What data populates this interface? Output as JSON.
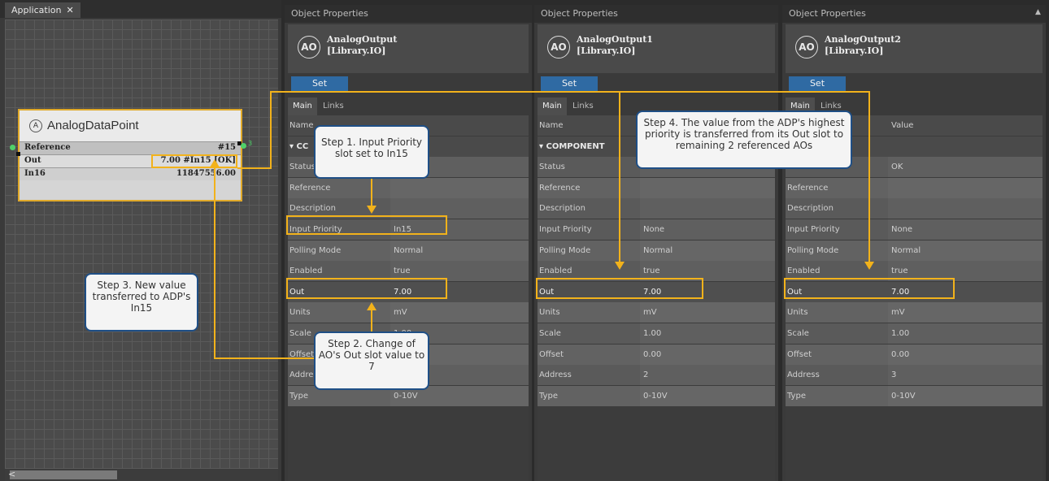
{
  "application": {
    "tab_label": "Application",
    "close_glyph": "✕",
    "scroll_left_glyph": "<"
  },
  "adp": {
    "icon_glyph": "A",
    "title": "AnalogDataPoint",
    "rows": [
      {
        "label": "Reference",
        "value": "#15"
      },
      {
        "label": "Out",
        "value": "7.00 #In15 [OK]"
      },
      {
        "label": "In16",
        "value": "11847556.00"
      }
    ],
    "out_pin_label": "3"
  },
  "panels": [
    {
      "title": "Object Properties",
      "object_name": "AnalogOutput",
      "object_lib": "[Library.IO]",
      "icon": "AO",
      "set_label": "Set",
      "tabs": {
        "main": "Main",
        "links": "Links"
      },
      "rows": [
        {
          "name": "Name",
          "value": ""
        },
        {
          "name": "▾ CC",
          "value": ""
        },
        {
          "name": "Status",
          "value": ""
        },
        {
          "name": "Reference",
          "value": ""
        },
        {
          "name": "Description",
          "value": ""
        },
        {
          "name": "Input Priority",
          "value": "In15"
        },
        {
          "name": "Polling Mode",
          "value": "Normal"
        },
        {
          "name": "Enabled",
          "value": "true"
        },
        {
          "name": "Out",
          "value": "7.00"
        },
        {
          "name": "Units",
          "value": "mV"
        },
        {
          "name": "Scale",
          "value": "1.00"
        },
        {
          "name": "Offset",
          "value": ""
        },
        {
          "name": "Addre",
          "value": ""
        },
        {
          "name": "Type",
          "value": "0-10V"
        }
      ]
    },
    {
      "title": "Object Properties",
      "object_name": "AnalogOutput1",
      "object_lib": "[Library.IO]",
      "icon": "AO",
      "set_label": "Set",
      "tabs": {
        "main": "Main",
        "links": "Links"
      },
      "rows": [
        {
          "name": "Name",
          "value": ""
        },
        {
          "name": "▾ COMPONENT",
          "value": ""
        },
        {
          "name": "Status",
          "value": ""
        },
        {
          "name": "Reference",
          "value": ""
        },
        {
          "name": "Description",
          "value": ""
        },
        {
          "name": "Input Priority",
          "value": "None"
        },
        {
          "name": "Polling Mode",
          "value": "Normal"
        },
        {
          "name": "Enabled",
          "value": "true"
        },
        {
          "name": "Out",
          "value": "7.00"
        },
        {
          "name": "Units",
          "value": "mV"
        },
        {
          "name": "Scale",
          "value": "1.00"
        },
        {
          "name": "Offset",
          "value": "0.00"
        },
        {
          "name": "Address",
          "value": "2"
        },
        {
          "name": "Type",
          "value": "0-10V"
        }
      ]
    },
    {
      "title": "Object Properties",
      "object_name": "AnalogOutput2",
      "object_lib": "[Library.IO]",
      "icon": "AO",
      "set_label": "Set",
      "tabs": {
        "main": "Main",
        "links": "Links"
      },
      "rows": [
        {
          "name": "",
          "value": "Value"
        },
        {
          "name": "ENT",
          "value": ""
        },
        {
          "name": "",
          "value": "OK"
        },
        {
          "name": "Reference",
          "value": ""
        },
        {
          "name": "Description",
          "value": ""
        },
        {
          "name": "Input Priority",
          "value": "None"
        },
        {
          "name": "Polling Mode",
          "value": "Normal"
        },
        {
          "name": "Enabled",
          "value": "true"
        },
        {
          "name": "Out",
          "value": "7.00"
        },
        {
          "name": "Units",
          "value": "mV"
        },
        {
          "name": "Scale",
          "value": "1.00"
        },
        {
          "name": "Offset",
          "value": "0.00"
        },
        {
          "name": "Address",
          "value": "3"
        },
        {
          "name": "Type",
          "value": "0-10V"
        }
      ]
    }
  ],
  "callouts": {
    "step1": "Step 1. Input Priority slot set to In15",
    "step2": "Step 2. Change of AO's Out slot value to 7",
    "step3": "Step 3. New value transferred to ADP's In15",
    "step4": "Step 4. The value from the ADP's highest priority is transferred from its Out slot to remaining 2 referenced AOs"
  },
  "colors": {
    "highlight": "#f2b21b",
    "callout_border": "#1f4f86",
    "set_button": "#2f6aa3"
  }
}
